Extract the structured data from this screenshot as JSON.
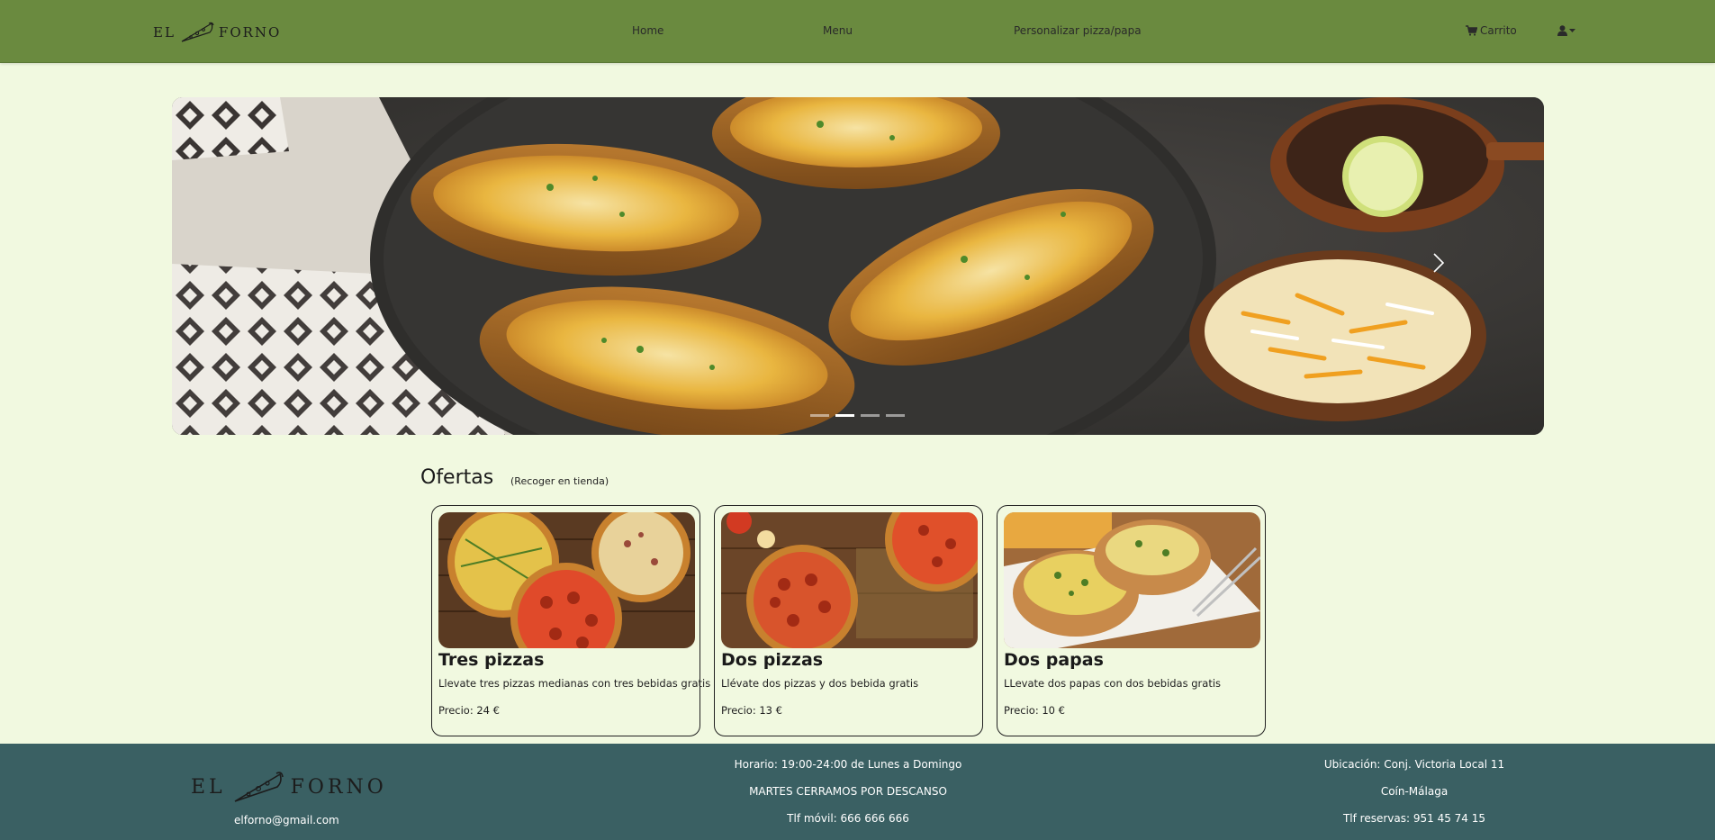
{
  "navbar": {
    "brand_left": "EL",
    "brand_right": "FORNO",
    "links": {
      "home": "Home",
      "menu": "Menu",
      "custom": "Personalizar pizza/papa",
      "cart": "Carrito"
    },
    "icons": {
      "cart": "cart-icon",
      "user": "user-icon",
      "caret": "caret-down-icon",
      "logo": "pizza-slice-icon"
    },
    "color": "#6a8a3f"
  },
  "carousel": {
    "next_icon": "chevron-right-icon",
    "slide_count": 4,
    "active_index": 1
  },
  "offers": {
    "title": "Ofertas",
    "subtitle": "(Recoger en tienda)",
    "cards": [
      {
        "title": "Tres pizzas",
        "desc": "Llevate tres pizzas medianas con tres bebidas gratis",
        "price": "Precio: 24 €"
      },
      {
        "title": "Dos pizzas",
        "desc": "Llévate dos pizzas y dos bebida gratis",
        "price": "Precio: 13 €"
      },
      {
        "title": "Dos papas",
        "desc": "LLevate dos papas con dos bebidas gratis",
        "price": "Precio: 10 €"
      }
    ]
  },
  "footer": {
    "brand_left": "EL",
    "brand_right": "FORNO",
    "email": "elforno@gmail.com",
    "schedule": "Horario: 19:00-24:00 de Lunes a Domingo",
    "closed": "MARTES CERRAMOS POR DESCANSO",
    "mobile": "Tlf móvil: 666 666 666",
    "location": "Ubicación: Conj. Victoria Local 11",
    "city": "Coín-Málaga",
    "reservations": "Tlf reservas: 951 45 74 15",
    "color": "#3a6063"
  }
}
